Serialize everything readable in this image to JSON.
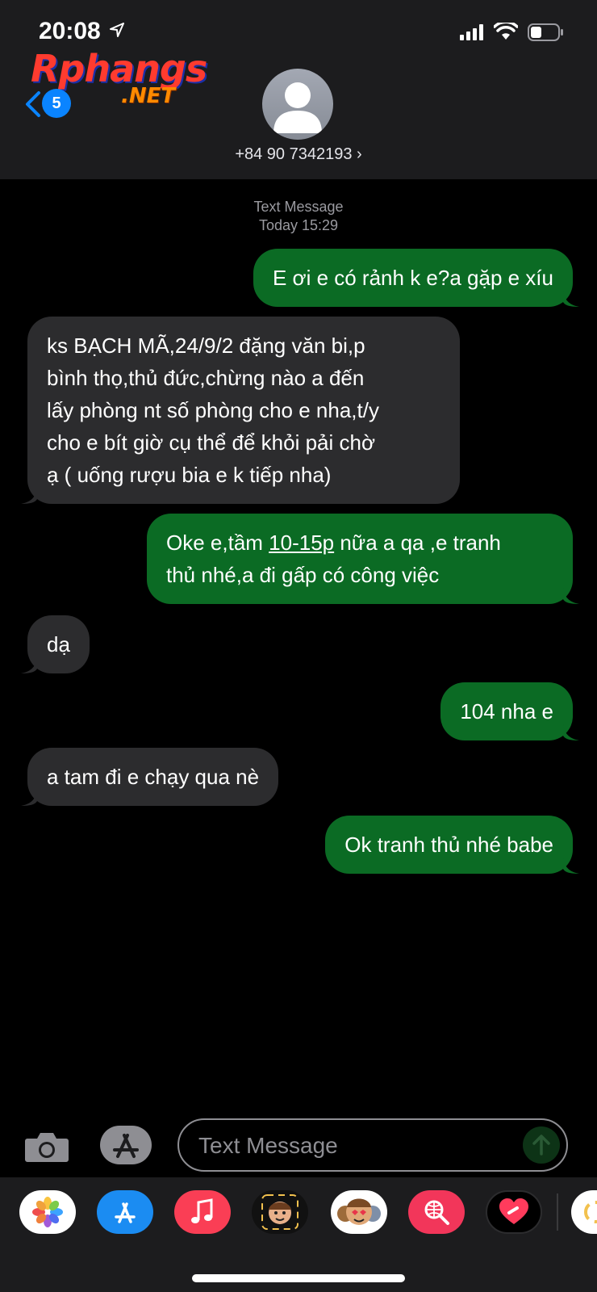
{
  "status": {
    "time": "20:08"
  },
  "watermark": {
    "main": "Rphangs",
    "sub": ".NET"
  },
  "nav": {
    "back_count": "5"
  },
  "contact": {
    "number": "+84 90 7342193 ›"
  },
  "thread": {
    "label": "Text Message",
    "date": "Today 15:29"
  },
  "messages": [
    {
      "from": "me",
      "lines": [
        "E ơi e có rảnh k e?a gặp e xíu"
      ]
    },
    {
      "from": "them",
      "lines": [
        "ks BẠCH MÃ,24/9/2 đặng văn bi,p",
        "bình thọ,thủ đức,chừng nào a đến",
        "lấy phòng nt số phòng cho e nha,t/y",
        "cho e bít giờ cụ thể để khỏi pải chờ",
        "ạ ( uống rượu bia e k tiếp nha)"
      ]
    },
    {
      "from": "me",
      "line1_pre": "Oke e,tầm ",
      "line1_link": "10-15p",
      "line1_post": " nữa a qa ,e tranh",
      "line2": "thủ nhé,a đi gấp có công việc"
    },
    {
      "from": "them",
      "lines": [
        "dạ"
      ]
    },
    {
      "from": "me",
      "lines": [
        "104 nha e"
      ]
    },
    {
      "from": "them",
      "lines": [
        "a tam đi e chạy qua nè"
      ]
    },
    {
      "from": "me",
      "lines": [
        "Ok tranh thủ nhé babe"
      ]
    }
  ],
  "composer": {
    "placeholder": "Text Message"
  },
  "tray": {
    "apps": [
      "photos-icon",
      "app-store-icon",
      "music-icon",
      "memoji-icon",
      "animoji-icon",
      "web-search-icon",
      "digital-touch-icon",
      "more-icon"
    ]
  },
  "colors": {
    "sent_bubble": "#0b6b24",
    "received_bubble": "#2c2c2e",
    "accent": "#0a84ff"
  }
}
